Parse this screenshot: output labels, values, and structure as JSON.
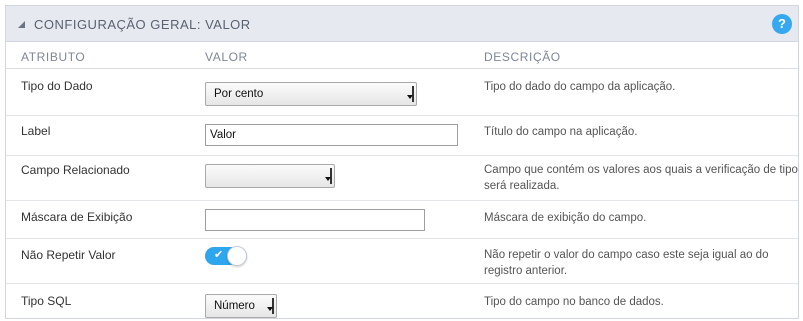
{
  "panel": {
    "title": "CONFIGURAÇÃO GERAL: VALOR",
    "help_label": "?"
  },
  "columns": {
    "attribute": "ATRIBUTO",
    "value": "VALOR",
    "description": "DESCRIÇÃO"
  },
  "rows": [
    {
      "attribute": "Tipo do Dado",
      "control": "select",
      "value": "Por cento",
      "description": "Tipo do dado do campo da aplicação."
    },
    {
      "attribute": "Label",
      "control": "text",
      "value": "Valor",
      "description": "Título do campo na aplicação."
    },
    {
      "attribute": "Campo Relacionado",
      "control": "select",
      "value": "",
      "description": "Campo que contém os valores aos quais a verificação de tipo será realizada."
    },
    {
      "attribute": "Máscara de Exibição",
      "control": "text",
      "value": "",
      "description": "Máscara de exibição do campo."
    },
    {
      "attribute": "Não Repetir Valor",
      "control": "toggle",
      "value": "✔",
      "checked": true,
      "description": "Não repetir o valor do campo caso este seja igual ao do registro anterior."
    },
    {
      "attribute": "Tipo SQL",
      "control": "select",
      "value": "Número",
      "description": "Tipo do campo no banco de dados."
    }
  ],
  "colors": {
    "header_bg": "#e6e9ef",
    "accent": "#36a8f0",
    "toggle_on": "#2ea6ee"
  }
}
